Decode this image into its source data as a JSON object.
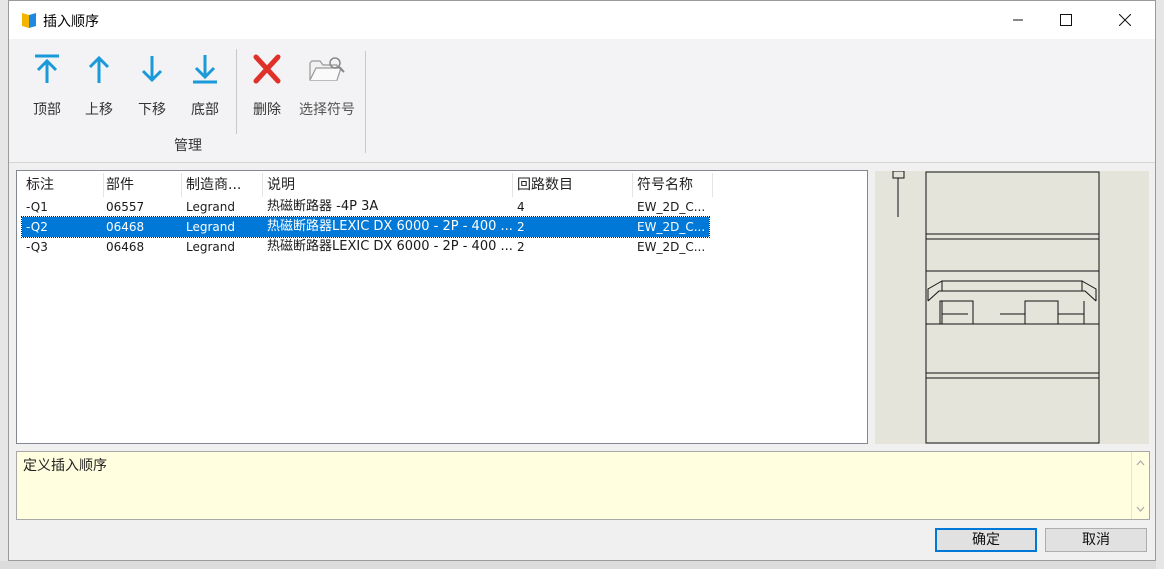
{
  "window": {
    "title": "插入顺序"
  },
  "ribbon": {
    "buttons": [
      {
        "label": "顶部",
        "icon": "move-to-top-icon"
      },
      {
        "label": "上移",
        "icon": "arrow-up-icon"
      },
      {
        "label": "下移",
        "icon": "arrow-down-icon"
      },
      {
        "label": "底部",
        "icon": "move-to-bottom-icon"
      },
      {
        "label": "删除",
        "icon": "delete-x-icon"
      },
      {
        "label": "选择符号",
        "icon": "folder-search-icon"
      }
    ],
    "group_label": "管理"
  },
  "table": {
    "columns": [
      "标注",
      "部件",
      "制造商...",
      "说明",
      "回路数目",
      "符号名称"
    ],
    "rows": [
      {
        "tag": "-Q1",
        "part": "06557",
        "manufacturer": "Legrand",
        "description": "热磁断路器 -4P 3A",
        "circuits": "4",
        "symbol": "EW_2D_C...",
        "selected": false
      },
      {
        "tag": "-Q2",
        "part": "06468",
        "manufacturer": "Legrand",
        "description": "热磁断路器LEXIC DX 6000 - 2P - 400 ...",
        "circuits": "2",
        "symbol": "EW_2D_C...",
        "selected": true
      },
      {
        "tag": "-Q3",
        "part": "06468",
        "manufacturer": "Legrand",
        "description": "热磁断路器LEXIC DX 6000 - 2P - 400 ...",
        "circuits": "2",
        "symbol": "EW_2D_C...",
        "selected": false
      }
    ]
  },
  "description_box": {
    "text": "定义插入顺序"
  },
  "footer": {
    "ok_label": "确定",
    "cancel_label": "取消"
  },
  "colors": {
    "accent": "#0078d7",
    "icon_blue": "#1a9ad9",
    "delete_red": "#e0302a",
    "desc_bg": "#ffffe0"
  }
}
